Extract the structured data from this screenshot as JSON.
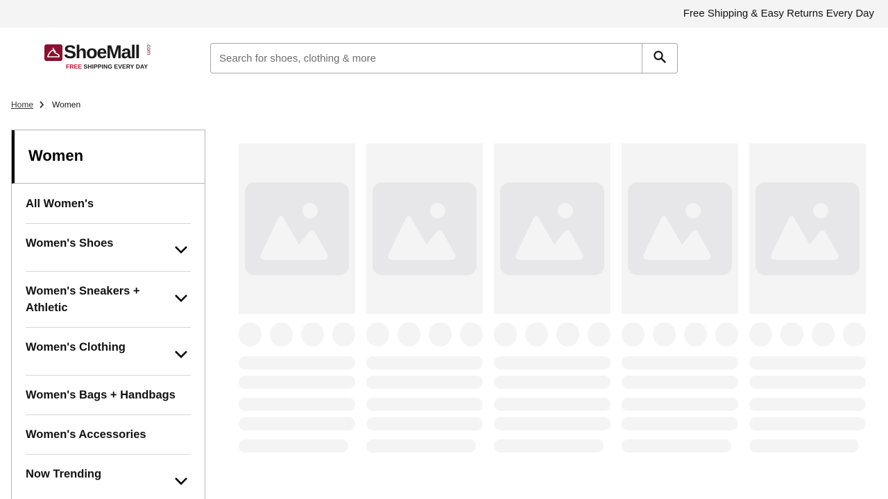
{
  "top_banner": {
    "text": "Free Shipping & Easy Returns Every Day"
  },
  "brand": {
    "name": "ShoeMall",
    "dotcom": ".com",
    "tagline_free": "FREE",
    "tagline_rest": " SHIPPING EVERY DAY",
    "accent_color": "#8a1130"
  },
  "search": {
    "placeholder": "Search for shoes, clothing & more",
    "value": "",
    "button_icon": "search-icon"
  },
  "breadcrumb": {
    "home": "Home",
    "separator_icon": "chevron-right-icon",
    "current": "Women"
  },
  "sidebar": {
    "title": "Women",
    "items": [
      {
        "label": "All Women's",
        "expandable": false
      },
      {
        "label": "Women's Shoes",
        "expandable": true
      },
      {
        "label": "Women's Sneakers + Athletic",
        "expandable": true
      },
      {
        "label": "Women's Clothing",
        "expandable": true
      },
      {
        "label": "Women's Bags + Handbags",
        "expandable": false
      },
      {
        "label": "Women's Accessories",
        "expandable": false
      },
      {
        "label": "Now Trending",
        "expandable": true
      }
    ]
  },
  "product_grid": {
    "state": "loading",
    "placeholder_cards": 5,
    "placeholder_icon": "image-placeholder-icon"
  }
}
